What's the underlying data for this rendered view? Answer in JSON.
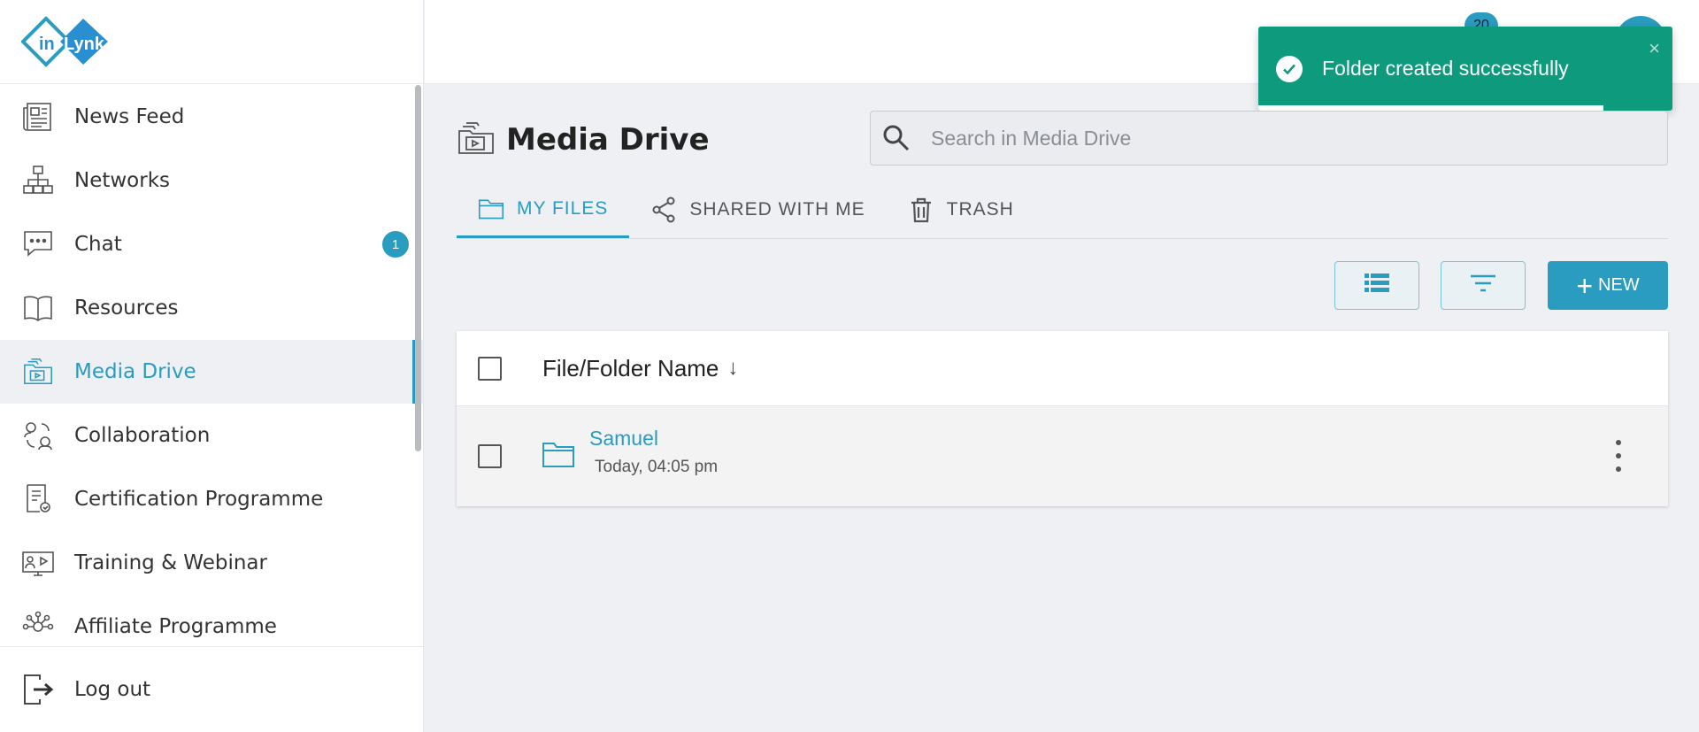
{
  "app": {
    "logo_text_in": "in",
    "logo_text_lynk": "Lynk"
  },
  "sidebar": {
    "items": [
      {
        "label": "News Feed",
        "icon": "newspaper-icon"
      },
      {
        "label": "Networks",
        "icon": "network-icon"
      },
      {
        "label": "Chat",
        "icon": "chat-icon",
        "badge": "1"
      },
      {
        "label": "Resources",
        "icon": "book-icon"
      },
      {
        "label": "Media Drive",
        "icon": "media-drive-icon",
        "active": true
      },
      {
        "label": "Collaboration",
        "icon": "collaboration-icon"
      },
      {
        "label": "Certification Programme",
        "icon": "certificate-icon"
      },
      {
        "label": "Training & Webinar",
        "icon": "webinar-icon"
      },
      {
        "label": "Affiliate Programme",
        "icon": "affiliate-icon"
      }
    ],
    "logout_label": "Log out"
  },
  "header": {
    "notification_count": "20"
  },
  "toast": {
    "message": "Folder created successfully",
    "close": "×"
  },
  "main": {
    "title": "Media Drive",
    "search_placeholder": "Search in Media Drive",
    "tabs": [
      {
        "label": "MY FILES",
        "icon": "folder-icon",
        "active": true
      },
      {
        "label": "SHARED WITH ME",
        "icon": "share-icon"
      },
      {
        "label": "TRASH",
        "icon": "trash-icon"
      }
    ],
    "new_button": "NEW",
    "table": {
      "column_name": "File/Folder Name",
      "sort_indicator": "↓",
      "rows": [
        {
          "name": "Samuel",
          "date": "Today, 04:05 pm"
        }
      ]
    }
  },
  "colors": {
    "accent": "#2a9cc0",
    "toast": "#0e9a7c"
  }
}
